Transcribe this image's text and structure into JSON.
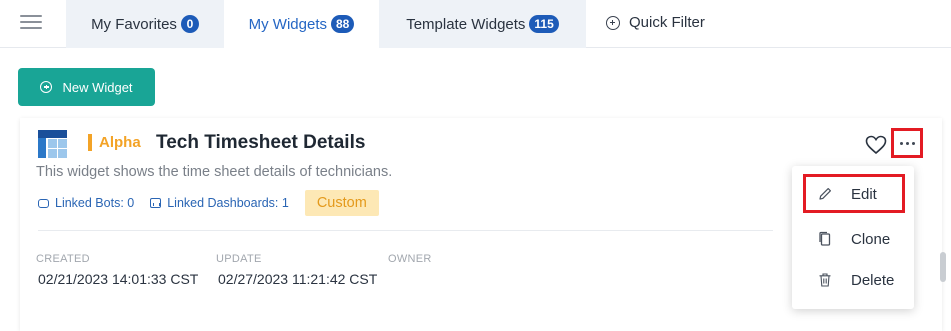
{
  "tabs": [
    {
      "label": "My Favorites",
      "count": "0"
    },
    {
      "label": "My Widgets",
      "count": "88"
    },
    {
      "label": "Template Widgets",
      "count": "115"
    }
  ],
  "quick_filter": {
    "label": "Quick Filter"
  },
  "new_widget": {
    "label": "New Widget"
  },
  "widget": {
    "tag": "Alpha",
    "title": "Tech Timesheet Details",
    "description": "This widget shows the time sheet details of technicians.",
    "linked_bots": "Linked Bots: 0",
    "linked_dashboards": "Linked Dashboards: 1",
    "type_badge": "Custom",
    "columns": [
      {
        "label": "CREATED",
        "value": "02/21/2023 14:01:33 CST"
      },
      {
        "label": "UPDATE",
        "value": "02/27/2023 11:21:42 CST"
      },
      {
        "label": "OWNER",
        "value": ""
      }
    ]
  },
  "menu": {
    "items": [
      {
        "label": "Edit",
        "icon": "pencil-icon"
      },
      {
        "label": "Clone",
        "icon": "copy-icon"
      },
      {
        "label": "Delete",
        "icon": "trash-icon"
      }
    ]
  },
  "colors": {
    "accent": "#19a596",
    "badge": "#1d5bb8",
    "tag": "#f3a327",
    "highlight": "#e31b23",
    "link": "#2a65b4"
  }
}
